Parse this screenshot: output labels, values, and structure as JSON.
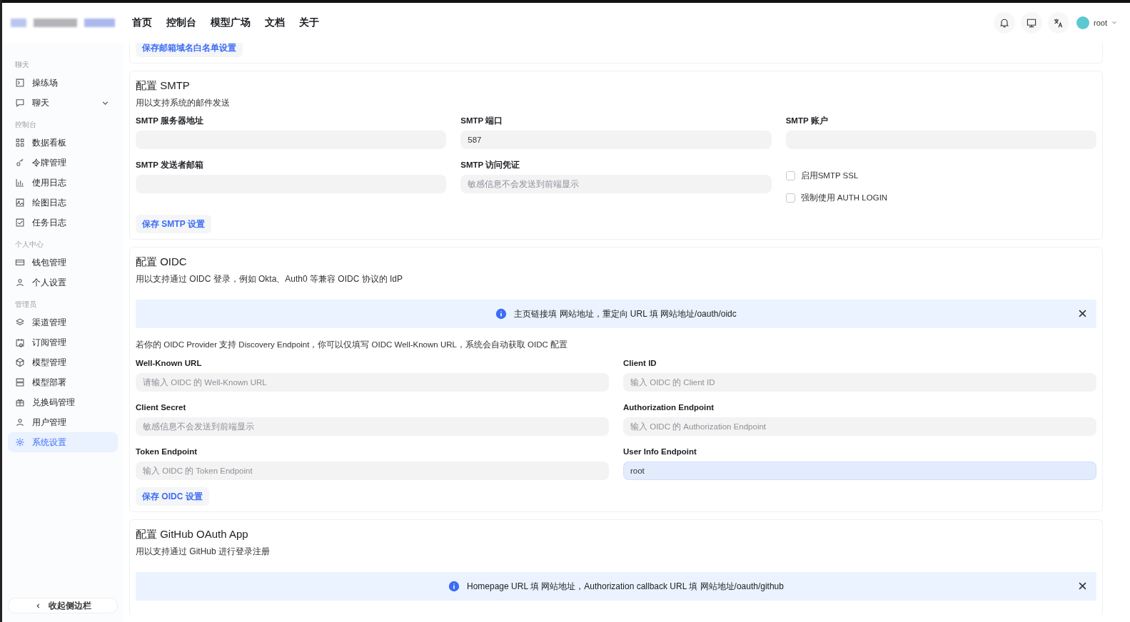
{
  "header": {
    "nav": [
      {
        "label": "首页",
        "selected": false
      },
      {
        "label": "控制台",
        "selected": false
      },
      {
        "label": "模型广场",
        "selected": false
      },
      {
        "label": "文档",
        "selected": false
      },
      {
        "label": "关于",
        "selected": false
      }
    ],
    "user": {
      "name": "root"
    }
  },
  "sidebar": {
    "groups": [
      {
        "title": "聊天",
        "items": [
          {
            "label": "操练场",
            "selected": false,
            "expandable": false
          },
          {
            "label": "聊天",
            "selected": false,
            "expandable": true
          }
        ]
      },
      {
        "title": "控制台",
        "items": [
          {
            "label": "数据看板",
            "selected": false,
            "expandable": false
          },
          {
            "label": "令牌管理",
            "selected": false,
            "expandable": false
          },
          {
            "label": "使用日志",
            "selected": false,
            "expandable": false
          },
          {
            "label": "绘图日志",
            "selected": false,
            "expandable": false
          },
          {
            "label": "任务日志",
            "selected": false,
            "expandable": false
          }
        ]
      },
      {
        "title": "个人中心",
        "items": [
          {
            "label": "钱包管理",
            "selected": false,
            "expandable": false
          },
          {
            "label": "个人设置",
            "selected": false,
            "expandable": false
          }
        ]
      },
      {
        "title": "管理员",
        "items": [
          {
            "label": "渠道管理",
            "selected": false,
            "expandable": false
          },
          {
            "label": "订阅管理",
            "selected": false,
            "expandable": false
          },
          {
            "label": "模型管理",
            "selected": false,
            "expandable": false
          },
          {
            "label": "模型部署",
            "selected": false,
            "expandable": false
          },
          {
            "label": "兑换码管理",
            "selected": false,
            "expandable": false
          },
          {
            "label": "用户管理",
            "selected": false,
            "expandable": false
          },
          {
            "label": "系统设置",
            "selected": true,
            "expandable": false
          }
        ]
      }
    ],
    "collapse": "收起侧边栏"
  },
  "top_card": {
    "button": "保存邮箱域名白名单设置"
  },
  "smtp": {
    "title": "配置 SMTP",
    "description": "用以支持系统的邮件发送",
    "fields": [
      {
        "kind": "input",
        "label": "SMTP 服务器地址"
      },
      {
        "kind": "input",
        "label": "SMTP 端口",
        "value": "587"
      },
      {
        "kind": "input",
        "label": "SMTP 账户"
      },
      {
        "kind": "input",
        "label": "SMTP 发送者邮箱"
      },
      {
        "kind": "input",
        "label": "SMTP 访问凭证",
        "placeholder": "敏感信息不会发送到前端显示"
      },
      {
        "kind": "checkboxes",
        "options": [
          {
            "label": "启用SMTP SSL",
            "checked": false
          },
          {
            "label": "强制使用 AUTH LOGIN",
            "checked": false
          }
        ]
      }
    ],
    "button": "保存 SMTP 设置"
  },
  "oidc": {
    "title": "配置 OIDC",
    "description": "用以支持通过 OIDC 登录，例如 Okta、Auth0 等兼容 OIDC 协议的 IdP",
    "alert": {
      "text": "主页链接填 网站地址，重定向 URL 填 网站地址/oauth/oidc"
    },
    "note": "若你的 OIDC Provider 支持 Discovery Endpoint，你可以仅填写 OIDC Well-Known URL，系统会自动获取 OIDC 配置",
    "fields": [
      {
        "label": "Well-Known URL",
        "placeholder": "请输入 OIDC 的 Well-Known URL",
        "highlighted": false
      },
      {
        "label": "Client ID",
        "placeholder": "输入 OIDC 的 Client ID",
        "highlighted": false
      },
      {
        "label": "Client Secret",
        "placeholder": "敏感信息不会发送到前端显示",
        "highlighted": false
      },
      {
        "label": "Authorization Endpoint",
        "placeholder": "输入 OIDC 的 Authorization Endpoint",
        "highlighted": false
      },
      {
        "label": "Token Endpoint",
        "placeholder": "输入 OIDC 的 Token Endpoint",
        "highlighted": false
      },
      {
        "label": "User Info Endpoint",
        "value": "root",
        "highlighted": true
      }
    ],
    "button": "保存 OIDC 设置"
  },
  "github": {
    "title": "配置 GitHub OAuth App",
    "description": "用以支持通过 GitHub 进行登录注册",
    "alert": {
      "text": "Homepage URL 填 网站地址，Authorization callback URL 填 网站地址/oauth/github"
    }
  }
}
